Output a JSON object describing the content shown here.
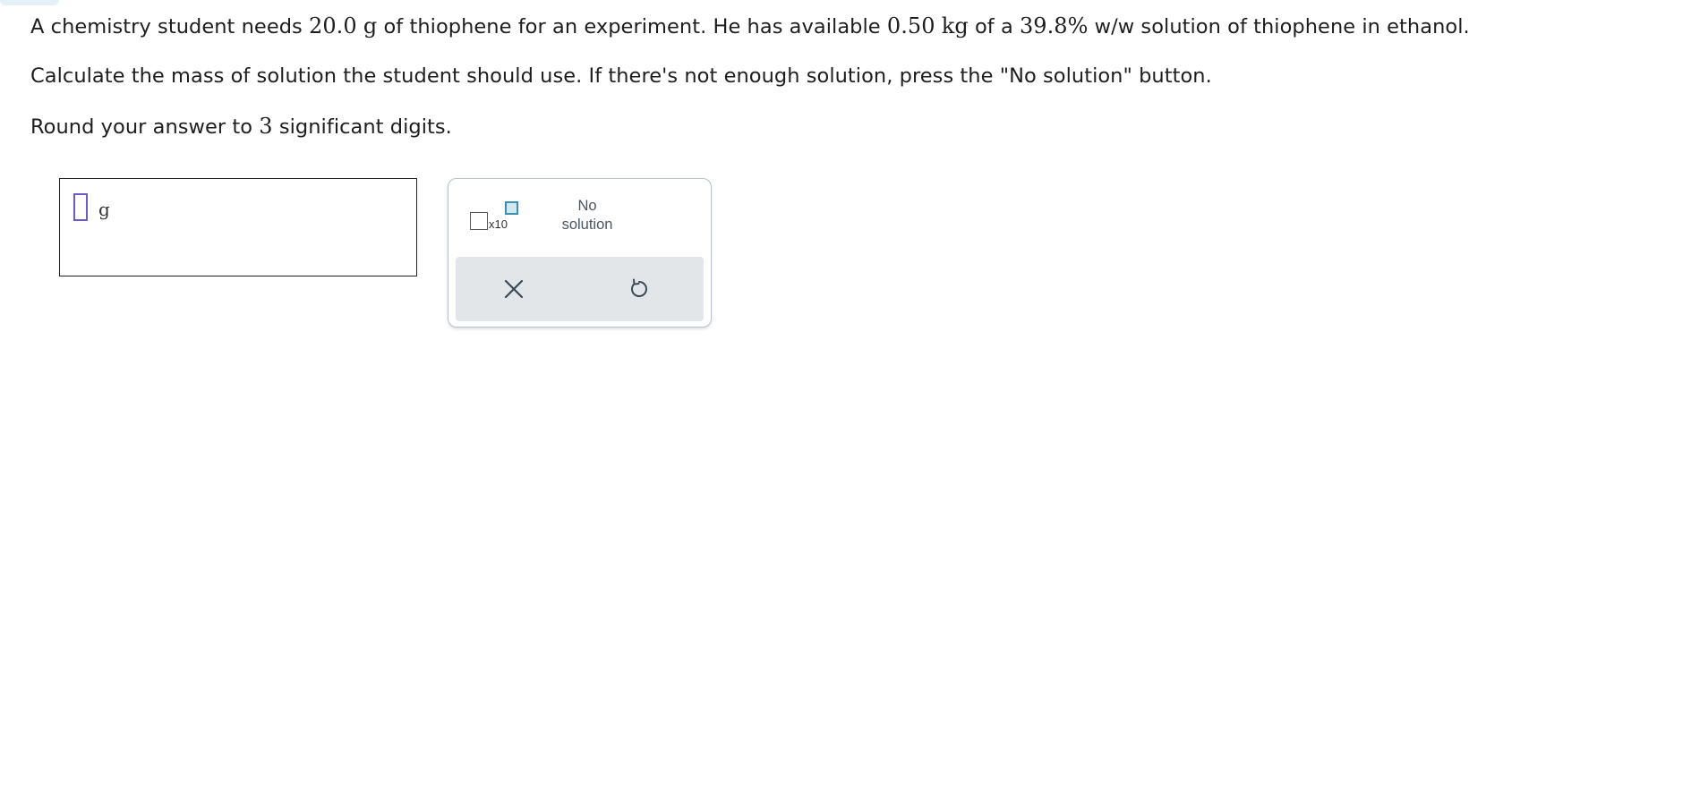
{
  "question": {
    "line1": {
      "part1": "A chemistry student needs ",
      "mass_needed": "20.0",
      "mass_needed_unit": "g",
      "part2": " of thiophene for an experiment. He has available ",
      "mass_available": "0.50",
      "mass_available_unit": "kg",
      "part3": " of a ",
      "percent": "39.8%",
      "part4": " w/w solution of thiophene in ethanol."
    },
    "line2": "Calculate the mass of solution the student should use. If there's not enough solution, press the \"No solution\" button.",
    "line3": {
      "part1": "Round your answer to ",
      "digits": "3",
      "part2": " significant digits."
    }
  },
  "answer": {
    "value": "",
    "unit": "g"
  },
  "tools": {
    "sci_notation_label": "x10",
    "no_solution_line1": "No",
    "no_solution_line2": "solution"
  },
  "colors": {
    "slot_border": "#6a5acd",
    "exponent_fill": "#cfe9f3",
    "action_bar": "#e2e6e9"
  }
}
